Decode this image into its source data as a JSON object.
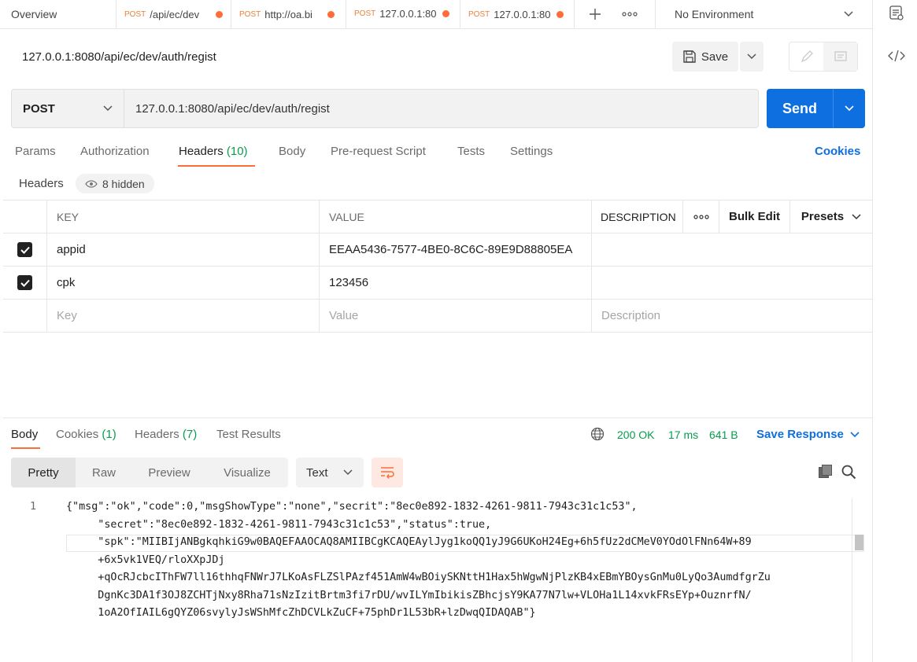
{
  "tabs": [
    {
      "label": "Overview",
      "method": "",
      "dirty": false,
      "active": false
    },
    {
      "label": "/api/ec/dev",
      "method": "POST",
      "dirty": true,
      "active": false
    },
    {
      "label": "http://oa.bi",
      "method": "POST",
      "dirty": true,
      "active": false
    },
    {
      "label": "127.0.0.1:80",
      "method": "POST",
      "dirty": true,
      "active": true
    },
    {
      "label": "127.0.0.1:80",
      "method": "POST",
      "dirty": true,
      "active": false
    }
  ],
  "environment": "No Environment",
  "request": {
    "title": "127.0.0.1:8080/api/ec/dev/auth/regist",
    "save_label": "Save",
    "method": "POST",
    "url": "127.0.0.1:8080/api/ec/dev/auth/regist",
    "send_label": "Send"
  },
  "request_tabs": [
    {
      "label": "Params",
      "count": ""
    },
    {
      "label": "Authorization",
      "count": ""
    },
    {
      "label": "Headers",
      "count": "(10)"
    },
    {
      "label": "Body",
      "count": ""
    },
    {
      "label": "Pre-request Script",
      "count": ""
    },
    {
      "label": "Tests",
      "count": ""
    },
    {
      "label": "Settings",
      "count": ""
    }
  ],
  "cookies_label": "Cookies",
  "headers_section": {
    "label": "Headers",
    "hidden_label": "8 hidden"
  },
  "table": {
    "columns": {
      "key": "KEY",
      "value": "VALUE",
      "description": "DESCRIPTION",
      "bulk_edit": "Bulk Edit",
      "presets": "Presets"
    },
    "rows": [
      {
        "checked": true,
        "key": "appid",
        "value": "EEAA5436-7577-4BE0-8C6C-89E9D88805EA",
        "description": ""
      },
      {
        "checked": true,
        "key": "cpk",
        "value": "123456",
        "description": ""
      }
    ],
    "placeholders": {
      "key": "Key",
      "value": "Value",
      "description": "Description"
    }
  },
  "response": {
    "tabs": [
      {
        "label": "Body",
        "count": ""
      },
      {
        "label": "Cookies",
        "count": "(1)"
      },
      {
        "label": "Headers",
        "count": "(7)"
      },
      {
        "label": "Test Results",
        "count": ""
      }
    ],
    "status": "200 OK",
    "time": "17 ms",
    "size": "641 B",
    "save_label": "Save Response",
    "views": [
      "Pretty",
      "Raw",
      "Preview",
      "Visualize"
    ],
    "format": "Text",
    "line_number": "1",
    "code_lines": [
      "{\"msg\":\"ok\",\"code\":0,\"msgShowType\":\"none\",\"secrit\":\"8ec0e892-1832-4261-9811-7943c31c1c53\",",
      "     \"secret\":\"8ec0e892-1832-4261-9811-7943c31c1c53\",\"status\":true,",
      "     \"spk\":\"MIIBIjANBgkqhkiG9w0BAQEFAAOCAQ8AMIIBCgKCAQEAylJyg1koQQ1yJ9G6UKoH24Eg+6h5fUz2dCMeV0YOdOlFNn64W+89",
      "     +6x5vk1VEQ/rloXXpJDj",
      "     +qOcRJcbcIThFW7ll16thhqFNWrJ7LKoAsFLZSlPAzf451AmW4wBOiySKNttH1Hax5hWgwNjPlzKB4xEBmYBOysGnMu0LyQo3AumdfgrZu",
      "     DgnKc3DA1f3OJ8ZCHTjNxy8Rha71sNzIzitBrtm3fi7rDU/wvILYmIbikisZBhcjsY9KA77N7lw+VLOHa1L14xvkFRsEYp+OuznrfN/",
      "     1oA2OfIAIL6gQYZ06svylyJsWShMfcZhDCVLkZuCF+75phDr1L53bR+lzDwqQIDAQAB\"}"
    ]
  },
  "colors": {
    "accent": "#ff6c37",
    "primary": "#0d6fe0",
    "success": "#0a9b4d"
  }
}
